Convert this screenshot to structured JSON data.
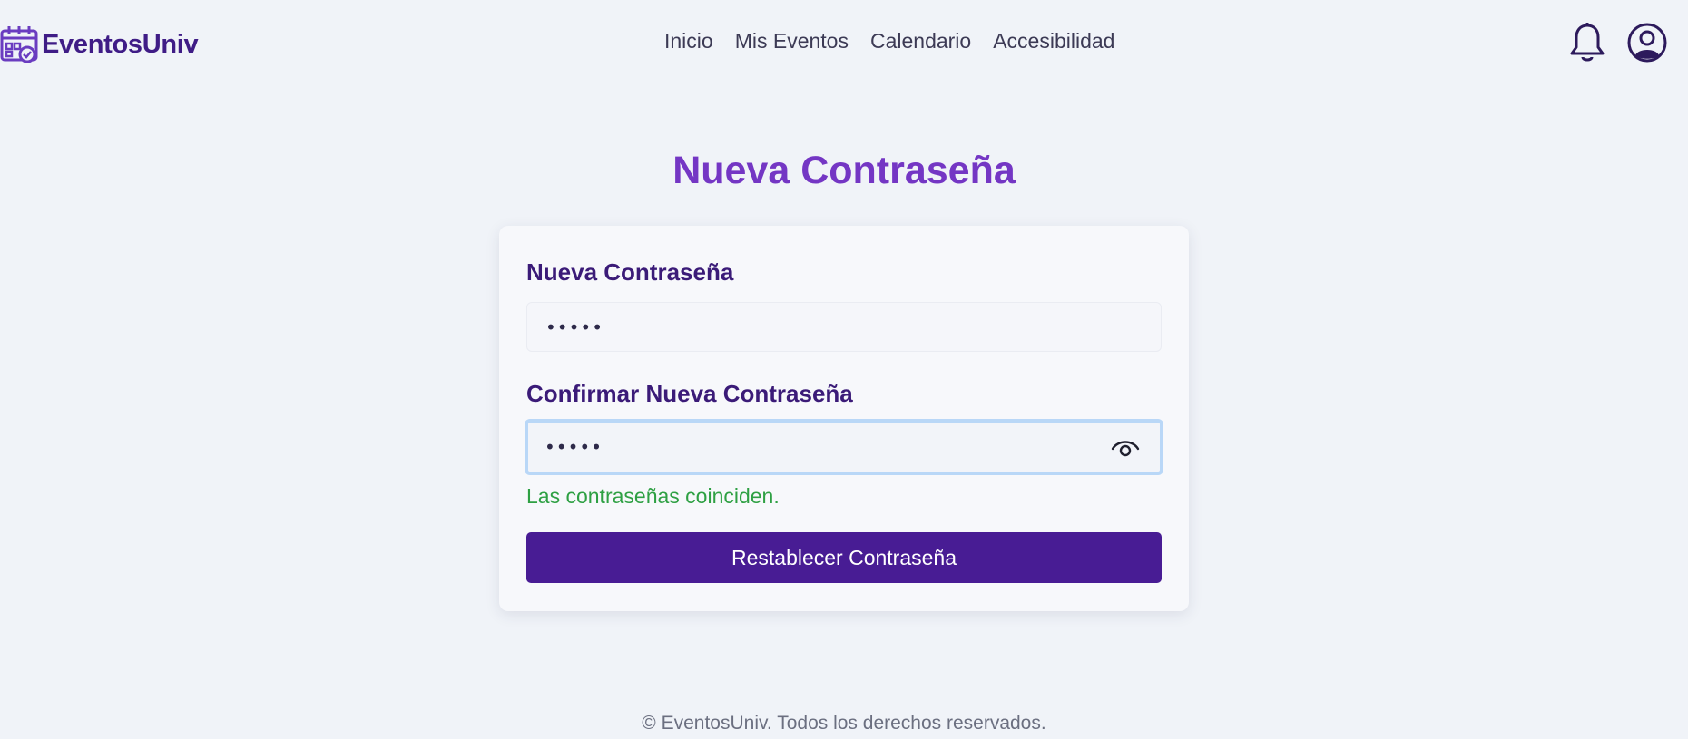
{
  "brand": {
    "icon": "calendar-check-icon",
    "name": "EventosUniv",
    "color": "#3f1c86"
  },
  "nav": {
    "items": [
      {
        "label": "Inicio"
      },
      {
        "label": "Mis Eventos"
      },
      {
        "label": "Calendario"
      },
      {
        "label": "Accesibilidad"
      }
    ]
  },
  "header_icons": {
    "notifications": "bell-icon",
    "profile": "user-circle-icon"
  },
  "page": {
    "title": "Nueva Contraseña",
    "title_color": "#7436c4"
  },
  "form": {
    "new_password": {
      "label": "Nueva Contraseña",
      "value": "•••••"
    },
    "confirm_password": {
      "label": "Confirmar Nueva Contraseña",
      "value": "•••••",
      "toggle_icon": "eye-icon"
    },
    "match_message": "Las contraseñas coinciden.",
    "match_color": "#2ea043",
    "submit_label": "Restablecer Contraseña",
    "submit_color": "#481c94"
  },
  "footer": {
    "text": "© EventosUniv. Todos los derechos reservados."
  }
}
